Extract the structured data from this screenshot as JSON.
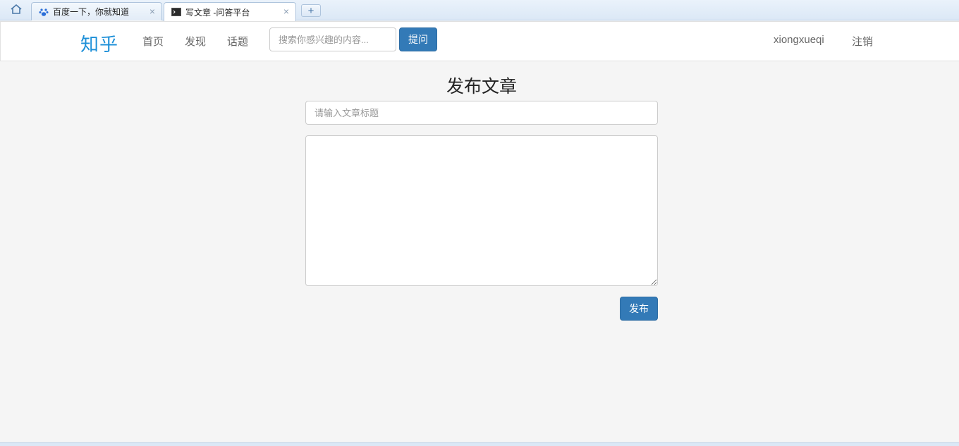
{
  "browser": {
    "home_icon": "home-icon",
    "tabs": [
      {
        "title": "百度一下，你就知道",
        "favicon": "baidu-paw-icon",
        "close": "×"
      },
      {
        "title": "写文章 -问答平台",
        "favicon": "terminal-icon",
        "close": "×"
      }
    ],
    "new_tab_label": "+"
  },
  "navbar": {
    "brand": "知乎",
    "links": [
      "首页",
      "发现",
      "话题"
    ],
    "search_placeholder": "搜索你感兴趣的内容...",
    "ask_label": "提问",
    "username": "xiongxueqi",
    "logout_label": "注销"
  },
  "main": {
    "heading": "发布文章",
    "title_placeholder": "请输入文章标题",
    "content_value": "",
    "publish_label": "发布"
  },
  "colors": {
    "brand": "#1e90d8",
    "primary_button": "#337ab7",
    "page_background": "#f5f5f5"
  }
}
